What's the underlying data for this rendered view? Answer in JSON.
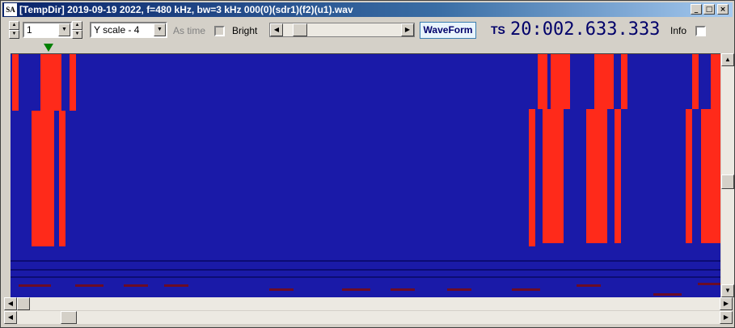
{
  "window": {
    "icon_label": "SA",
    "title": "[TempDir] 2019-09-19 2022, f=480 kHz, bw=3 kHz 000(0)(sdr1)(f2)(u1).wav",
    "minimize": "_",
    "maximize": "□",
    "close": "×"
  },
  "toolbar": {
    "channel_value": "1",
    "yscale_value": "Y scale - 4",
    "as_time_label": "As time",
    "bright_label": "Bright",
    "waveform_label": "WaveForm",
    "ts_label": "TS",
    "ts_value": "20:002.633.333",
    "info_label": "Info"
  },
  "colors": {
    "background": "#1a1aa8",
    "signal": "#ff2a1a",
    "marker": "#008000"
  },
  "icons": [
    "spin-up-icon",
    "spin-down-icon",
    "dropdown-arrow-icon",
    "scroll-left-icon",
    "scroll-right-icon",
    "marker-triangle-icon"
  ]
}
